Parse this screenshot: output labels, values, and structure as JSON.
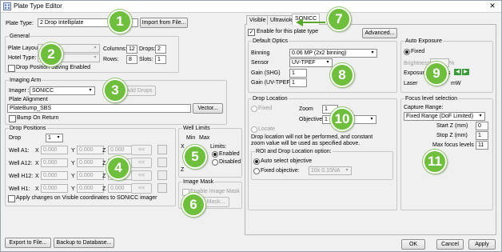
{
  "window": {
    "title": "Plate Type Editor",
    "close": "✕"
  },
  "plate_type": {
    "label": "Plate Type:",
    "value": "2 Drop Intelliplate",
    "import_button": "Import from File..."
  },
  "general": {
    "caption": "General",
    "plate_layout_label": "Plate Layout:",
    "hotel_type_label": "Hotel Type:",
    "columns_label": "Columns:",
    "columns_value": "12",
    "drops_label": "Drops:",
    "drops_value": "2",
    "rows_label": "Rows:",
    "rows_value": "8",
    "slots_label": "Slots:",
    "slots_value": "1",
    "drop_position_saving": "Drop Position Saving Enabled"
  },
  "imaging_arm": {
    "caption": "Imaging Arm",
    "imager_label": "Imager :",
    "imager_value": "SONICC",
    "add_drops_button": "Add Drops",
    "plate_alignment_caption": "Plate Alignment",
    "plate_alignment_value": "PlateBump_SBS",
    "vector_button": "Vector...",
    "bump_on_return": "Bump On Return"
  },
  "drop_positions": {
    "caption": "Drop Positions",
    "drop_label": "Drop",
    "drop_value": "1",
    "wells": [
      {
        "label": "Well A1:",
        "x": "0.000",
        "y": "0.000",
        "z": "0.000"
      },
      {
        "label": "Well A12:",
        "x": "0.000",
        "y": "0.000",
        "z": "0.000"
      },
      {
        "label": "Well H12:",
        "x": "0.000",
        "y": "0.000",
        "z": "0.000"
      },
      {
        "label": "Well H1:",
        "x": "0.000",
        "y": "0.000",
        "z": "0.000"
      }
    ],
    "x_label": "X",
    "y_label": "Y",
    "z_label": "Z",
    "go_button": "<<",
    "apply_changes": "Apply changes on Visible coordinates to SONICC imager"
  },
  "well_limits": {
    "caption": "Well Limits",
    "min_label": "Min",
    "max_label": "Max",
    "x_label": "X",
    "z_label": "Z",
    "limits_label": "Limits:",
    "enabled": "Enabled",
    "disabled": "Disabled"
  },
  "image_mask": {
    "caption": "Image Mask",
    "enable_label": "Enable Image Mask",
    "mask_button": "Mask..."
  },
  "bottom_left": {
    "export_button": "Export to File...",
    "backup_button": "Backup to Database..."
  },
  "tabs": [
    {
      "label": "Visible"
    },
    {
      "label": "Ultraviolet"
    },
    {
      "label": "SONICC"
    }
  ],
  "sonicc": {
    "enable_label": "Enable for this plate type",
    "advanced_button": "Advanced...",
    "default_optics": {
      "caption": "Default Optics",
      "binning_label": "Binning",
      "binning_value": "0.06  MP (2x2 binning)",
      "sensor_label": "Sensor",
      "sensor_value": "UV-TPEF",
      "gain_shg_label": "Gain (SHG)",
      "gain_shg_value": "1",
      "gain_uv_label": "Gain (UV-TPEF)",
      "gain_uv_value": "1"
    },
    "auto_exposure": {
      "caption": "Auto Exposure",
      "fixed_label": "Fixed",
      "brightness_label": "Brightness",
      "percent": "%",
      "exposure_label": "Exposure",
      "ms": "ms",
      "laser_label": "Laser",
      "mw": "mW"
    },
    "drop_location": {
      "caption": "Drop Location",
      "fixed_label": "Fixed",
      "zoom_label": "Zoom",
      "zoom_value": "1",
      "objective_label": "Objective",
      "objective_value": "1",
      "locate_label": "Locate",
      "note": "Drop location will not be performed, and constant zoom value will be used as specified above."
    },
    "roi": {
      "caption": "ROI and Drop Location option:",
      "auto_select": "Auto select objective",
      "fixed_objective": "Fixed objective:",
      "fixed_objective_value": "10x 0.15NA"
    },
    "focus_level": {
      "caption": "Focus level selection",
      "capture_range_label": "Capture Range:",
      "capture_range_value": "Fixed Range (DoF Limited)",
      "start_z_label": "Start Z (mm)",
      "start_z_value": "0",
      "stop_z_label": "Stop Z (mm)",
      "stop_z_value": "1",
      "max_focus_label": "Max focus levels",
      "max_focus_value": "11"
    }
  },
  "footer": {
    "ok": "OK",
    "cancel": "Cancel",
    "apply": "Apply"
  },
  "callouts": [
    "1",
    "2",
    "3",
    "4",
    "5",
    "6",
    "7",
    "8",
    "9",
    "10",
    "11"
  ],
  "colors": {
    "callout": "#6fbe3e",
    "arrow": "#5aa62e"
  }
}
